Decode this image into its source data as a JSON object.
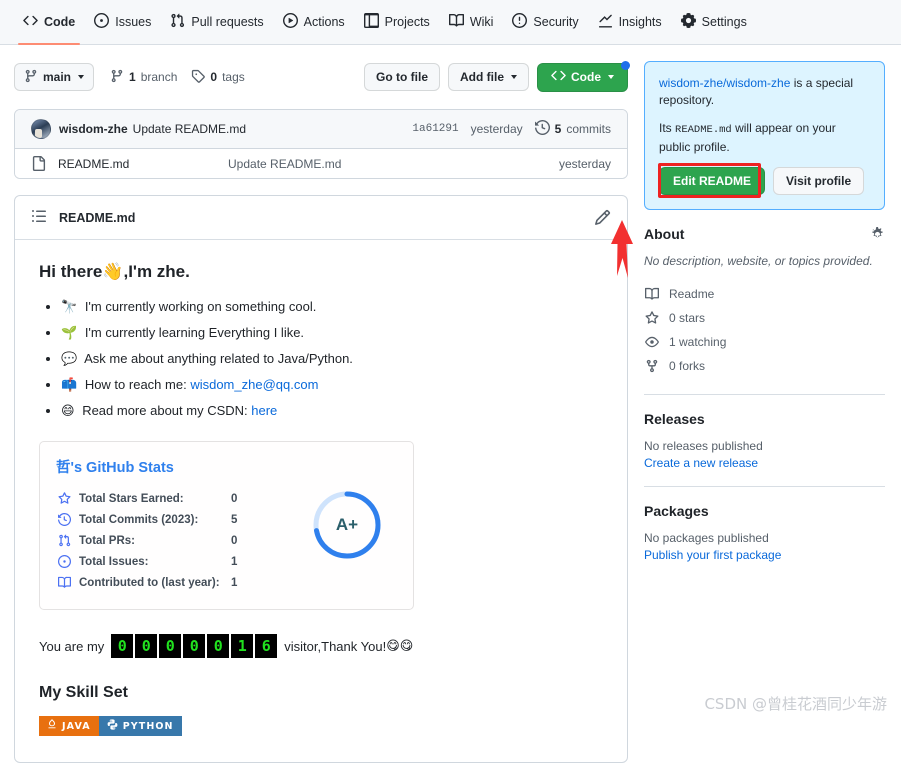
{
  "nav": {
    "items": [
      {
        "label": "Code",
        "icon": "code-icon",
        "active": true
      },
      {
        "label": "Issues",
        "icon": "issue-opened-icon",
        "active": false
      },
      {
        "label": "Pull requests",
        "icon": "git-pull-request-icon",
        "active": false
      },
      {
        "label": "Actions",
        "icon": "play-icon",
        "active": false
      },
      {
        "label": "Projects",
        "icon": "table-icon",
        "active": false
      },
      {
        "label": "Wiki",
        "icon": "book-icon",
        "active": false
      },
      {
        "label": "Security",
        "icon": "shield-icon",
        "active": false
      },
      {
        "label": "Insights",
        "icon": "graph-icon",
        "active": false
      },
      {
        "label": "Settings",
        "icon": "gear-icon",
        "active": false
      }
    ]
  },
  "toolbar": {
    "branch": "main",
    "branch_icon": "git-branch-icon",
    "branch_count": "1",
    "branch_count_label": "branch",
    "tag_count": "0",
    "tag_count_label": "tags",
    "tag_icon": "tag-icon",
    "go_to_file": "Go to file",
    "add_file": "Add file",
    "code_button": "Code",
    "code_icon": "code-icon",
    "has_notification_dot": true
  },
  "commit": {
    "author": "wisdom-zhe",
    "message": "Update README.md",
    "sha": "1a61291",
    "date": "yesterday",
    "commit_count": "5",
    "commit_count_label": "commits",
    "history_icon": "history-icon"
  },
  "files": [
    {
      "name": "README.md",
      "icon": "file-icon",
      "commit_message": "Update README.md",
      "date": "yesterday"
    }
  ],
  "readme": {
    "header_title": "README.md",
    "list_icon": "list-unordered-icon",
    "pencil_icon": "pencil-icon",
    "heading": "Hi there 👋,I'm zhe.",
    "heading_text_before": "Hi there ",
    "heading_emoji": "👋",
    "heading_text_after": ",I'm zhe.",
    "bullets": [
      {
        "emoji": "🔭",
        "text": "I'm currently working on something cool."
      },
      {
        "emoji": "🌱",
        "text": "I'm currently learning Everything I like."
      },
      {
        "emoji": "💬",
        "text": "Ask me about anything related to Java/Python."
      },
      {
        "emoji": "📫",
        "text": "How to reach me: ",
        "link": "wisdom_zhe@qq.com"
      },
      {
        "emoji": "😄",
        "text": "Read more about my CSDN: ",
        "link": "here"
      }
    ],
    "visitor": {
      "prefix": "You are my",
      "digits": [
        "0",
        "0",
        "0",
        "0",
        "0",
        "1",
        "6"
      ],
      "suffix": "visitor,Thank You!",
      "suffix_emoji": "😋😋"
    },
    "skills_heading": "My Skill Set",
    "badges": [
      {
        "label": "JAVA",
        "icon": "java-icon",
        "color": "#e8700f"
      },
      {
        "label": "PYTHON",
        "icon": "python-icon",
        "color": "#3878ab"
      }
    ]
  },
  "stats_card": {
    "title": "哲's GitHub Stats",
    "title_color": "#2f80ed",
    "rank": "A+",
    "ring_color": "#2f80ed",
    "ring_track_color": "#cfe3fc",
    "ring_percent": 72,
    "rows": [
      {
        "icon": "star-icon",
        "label": "Total Stars Earned:",
        "value": "0"
      },
      {
        "icon": "clock-icon",
        "label": "Total Commits (2023):",
        "value": "5"
      },
      {
        "icon": "git-pull-request-icon",
        "label": "Total PRs:",
        "value": "0"
      },
      {
        "icon": "issue-opened-icon",
        "label": "Total Issues:",
        "value": "1"
      },
      {
        "icon": "repo-icon",
        "label": "Contributed to (last year):",
        "value": "1"
      }
    ]
  },
  "sidebar": {
    "special": {
      "repo_name": "wisdom-zhe/wisdom-zhe",
      "line1_suffix": " is a special repository.",
      "line2_prefix": "Its ",
      "line2_mono": "README.md",
      "line2_suffix": " will appear on your public profile.",
      "edit_readme": "Edit README",
      "visit_profile": "Visit profile"
    },
    "about": {
      "title": "About",
      "gear_icon": "gear-icon",
      "description": "No description, website, or topics provided.",
      "rows": [
        {
          "icon": "book-icon",
          "label": "Readme"
        },
        {
          "icon": "star-icon",
          "label": "0 stars"
        },
        {
          "icon": "eye-icon",
          "label": "1 watching"
        },
        {
          "icon": "fork-icon",
          "label": "0 forks"
        }
      ]
    },
    "releases": {
      "title": "Releases",
      "empty": "No releases published",
      "link": "Create a new release"
    },
    "packages": {
      "title": "Packages",
      "empty": "No packages published",
      "link": "Publish your first package"
    }
  },
  "watermark": "CSDN @曾桂花酒同少年游",
  "colors": {
    "github_green": "#2da44e",
    "link_blue": "#0969da",
    "active_tab_underline": "#fd8c73",
    "annotation_red": "#ee2222",
    "counter_green": "#21e21f",
    "special_bg": "#ddf4ff"
  }
}
